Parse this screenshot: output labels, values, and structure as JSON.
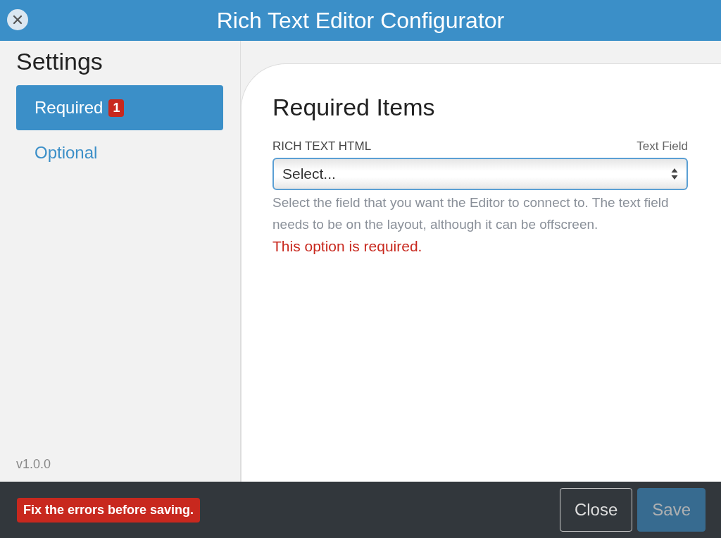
{
  "window": {
    "title": "Rich Text Editor Configurator"
  },
  "sidebar": {
    "title": "Settings",
    "items": [
      {
        "label": "Required",
        "badge": "1",
        "selected": true
      },
      {
        "label": "Optional",
        "selected": false
      }
    ],
    "version": "v1.0.0"
  },
  "main": {
    "heading": "Required Items",
    "fields": [
      {
        "label": "RICH TEXT HTML",
        "type_label": "Text Field",
        "value": "Select...",
        "help": "Select the field that you want the Editor to connect to. The text field needs to be on the layout, although it can be offscreen.",
        "error": "This option is required."
      }
    ]
  },
  "footer": {
    "error": "Fix the errors before saving.",
    "buttons": [
      {
        "label": "Close",
        "kind": "outline",
        "disabled": false
      },
      {
        "label": "Save",
        "kind": "primary",
        "disabled": true
      }
    ]
  }
}
